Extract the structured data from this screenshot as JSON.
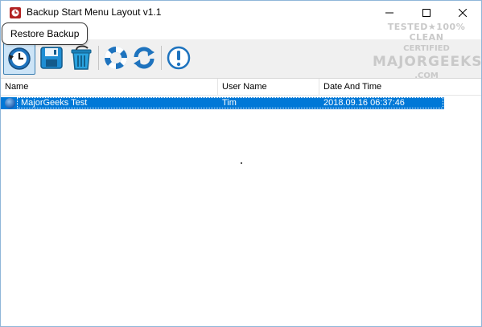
{
  "window": {
    "title": "Backup Start Menu Layout v1.1",
    "controls": {
      "minimize": "—",
      "maximize": "☐",
      "close": "✕"
    }
  },
  "tooltip": {
    "text": "Restore Backup"
  },
  "toolbar": {
    "buttons": [
      {
        "icon": "restore-icon",
        "label": "Restore Backup"
      },
      {
        "icon": "save-icon"
      },
      {
        "icon": "trash-icon"
      },
      {
        "icon": "lifebuoy-icon"
      },
      {
        "icon": "refresh-icon"
      },
      {
        "icon": "info-icon"
      }
    ]
  },
  "list": {
    "columns": [
      "Name",
      "User Name",
      "Date And Time"
    ],
    "rows": [
      {
        "name": "MajorGeeks Test",
        "user": "Tim",
        "datetime": "2018.09.16 06:37:46"
      }
    ]
  },
  "watermark": {
    "line1": "TESTED★100% CLEAN",
    "line2": "CERTIFIED",
    "line3": "MAJORGEEKS",
    "line4": ".COM"
  },
  "colors": {
    "selection": "#0078d7",
    "accent": "#3c7fb1"
  }
}
